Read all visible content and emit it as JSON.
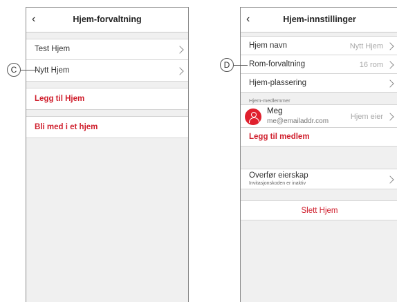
{
  "left_screen": {
    "title": "Hjem-forvaltning",
    "items": [
      "Test Hjem",
      "Nytt Hjem"
    ],
    "add_home": "Legg til Hjem",
    "join_home": "Bli med i et hjem"
  },
  "right_screen": {
    "title": "Hjem-innstillinger",
    "home_name_label": "Hjem navn",
    "home_name_value": "Nytt Hjem",
    "room_mgmt_label": "Rom-forvaltning",
    "room_mgmt_value": "16 rom",
    "location_label": "Hjem-plassering",
    "members_section": "Hjem-medlemmer",
    "member_name": "Meg",
    "member_email": "me@emailaddr.com",
    "member_role": "Hjem eier",
    "add_member": "Legg til medlem",
    "transfer_label": "Overfør eierskap",
    "transfer_sub": "Invitasjonskoden er inaktiv",
    "delete_home": "Slett Hjem"
  },
  "callouts": {
    "c": "C",
    "d": "D"
  },
  "colors": {
    "accent_red": "#d0202e",
    "background": "#f0f0f0"
  },
  "icons": [
    "back-arrow-icon",
    "chevron-right-icon",
    "user-avatar-icon"
  ]
}
